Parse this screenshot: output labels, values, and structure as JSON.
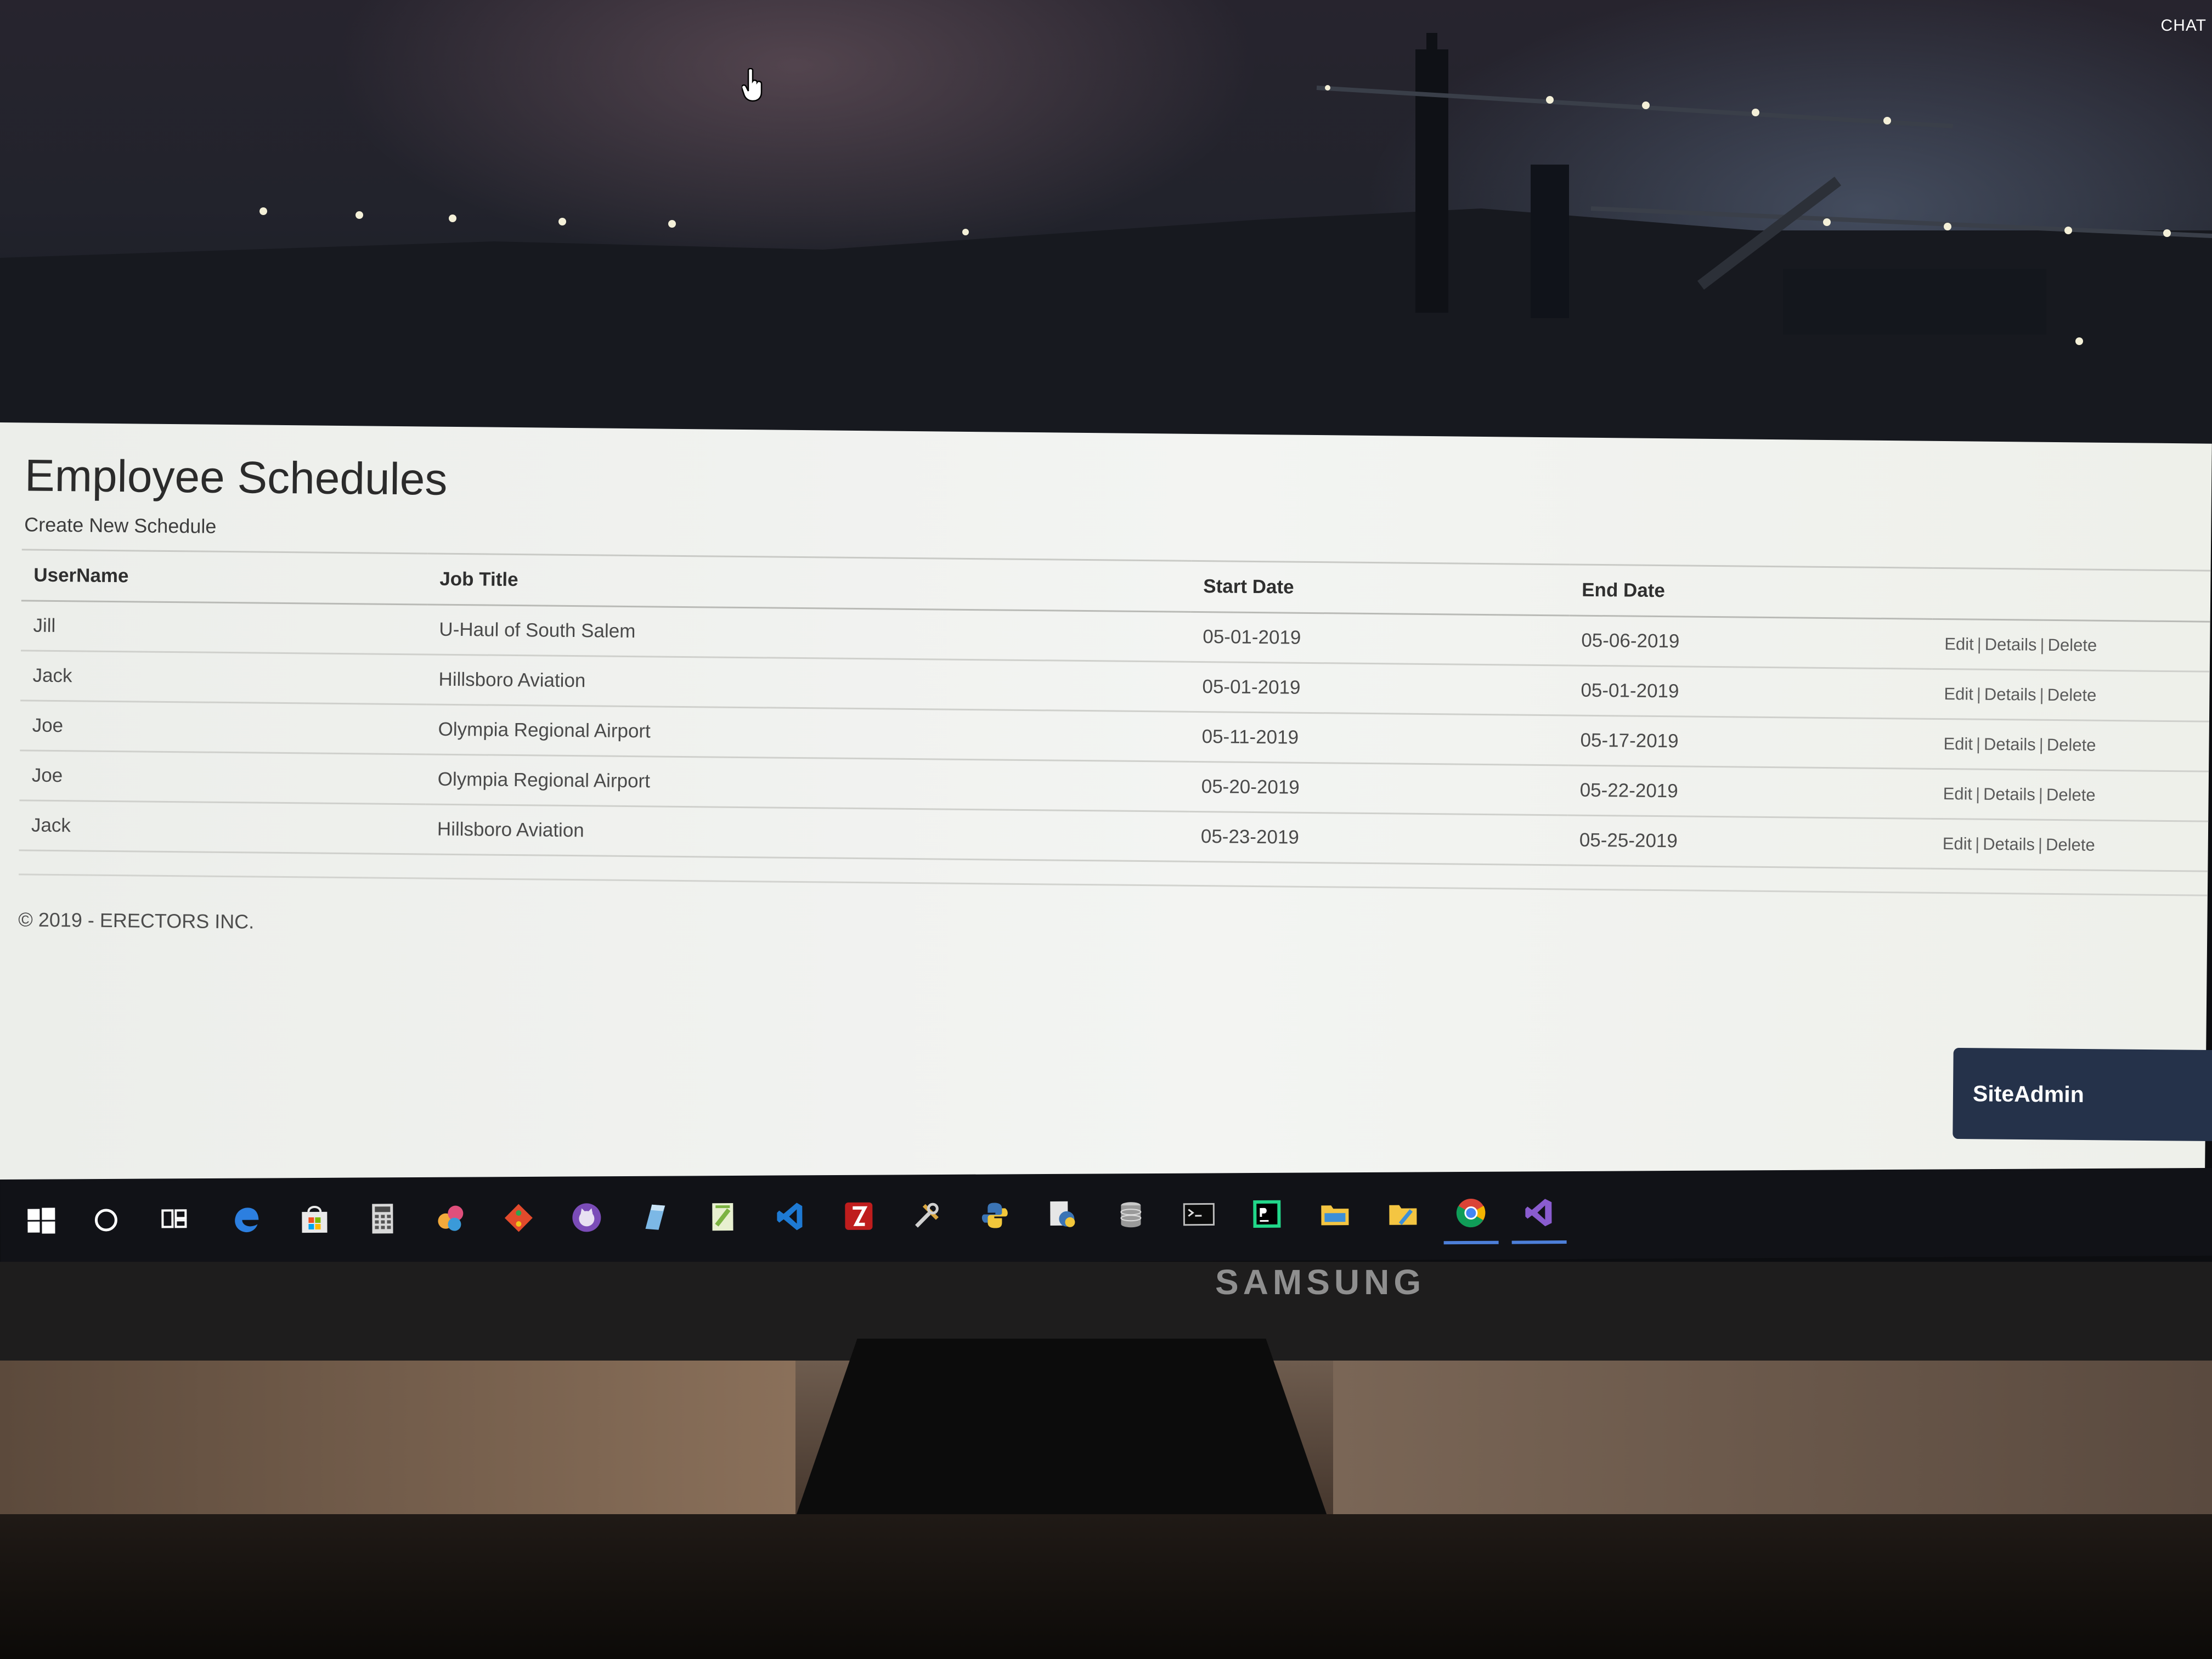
{
  "browser": {
    "chat_label": "CHAT"
  },
  "page": {
    "title": "Employee Schedules",
    "create_link": "Create New Schedule",
    "columns": [
      "UserName",
      "Job Title",
      "Start Date",
      "End Date"
    ],
    "rows": [
      {
        "user": "Jill",
        "job": "U-Haul of South Salem",
        "start": "05-01-2019",
        "end": "05-06-2019"
      },
      {
        "user": "Jack",
        "job": "Hillsboro Aviation",
        "start": "05-01-2019",
        "end": "05-01-2019"
      },
      {
        "user": "Joe",
        "job": "Olympia Regional Airport",
        "start": "05-11-2019",
        "end": "05-17-2019"
      },
      {
        "user": "Joe",
        "job": "Olympia Regional Airport",
        "start": "05-20-2019",
        "end": "05-22-2019"
      },
      {
        "user": "Jack",
        "job": "Hillsboro Aviation",
        "start": "05-23-2019",
        "end": "05-25-2019"
      }
    ],
    "row_actions": {
      "edit": "Edit",
      "details": "Details",
      "delete": "Delete",
      "separator": "|"
    },
    "footer": "© 2019 - ERECTORS INC."
  },
  "chat_widget": {
    "label": "SiteAdmin"
  },
  "taskbar": {
    "icons": [
      "start-icon",
      "cortana-icon",
      "task-view-icon",
      "edge-icon",
      "store-icon",
      "calculator-icon",
      "paint-3d-icon",
      "git-icon",
      "github-icon",
      "azure-storage-explorer-icon",
      "notepad-plus-icon",
      "vscode-icon",
      "filezilla-icon",
      "build-tools-icon",
      "python-icon",
      "python-files-icon",
      "database-icon",
      "terminal-icon",
      "pycharm-icon",
      "file-explorer-icon",
      "folder-tools-icon",
      "chrome-icon",
      "visual-studio-icon"
    ],
    "active": [
      "chrome-icon",
      "visual-studio-icon"
    ]
  },
  "monitor": {
    "brand": "SAMSUNG"
  },
  "colors": {
    "widget": "#25324a",
    "taskbar": "#111217",
    "active_underline": "#4d7fd9"
  }
}
